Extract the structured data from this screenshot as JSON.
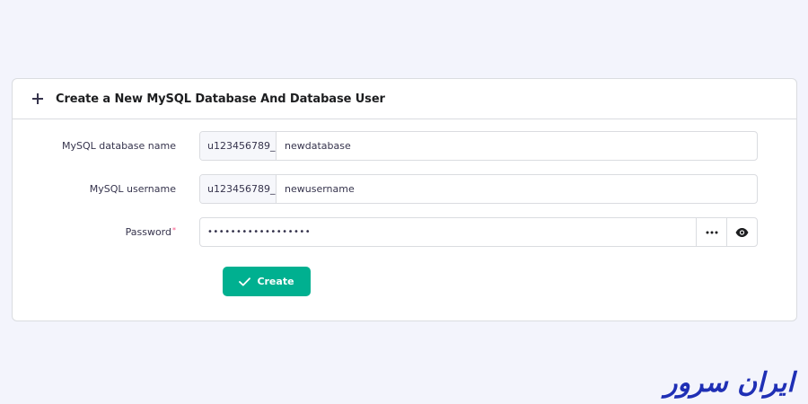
{
  "card": {
    "title": "Create a New MySQL Database And Database User"
  },
  "form": {
    "db_name": {
      "label": "MySQL database name",
      "prefix": "u123456789_",
      "value": "newdatabase"
    },
    "username": {
      "label": "MySQL username",
      "prefix": "u123456789_",
      "value": "newusername"
    },
    "password": {
      "label": "Password",
      "required_mark": "*",
      "value": "••••••••••••••••••"
    },
    "submit_label": "Create"
  },
  "icons": {
    "header": "plus-icon",
    "generate": "generate-password-icon",
    "reveal": "eye-icon",
    "submit": "checkmark-icon"
  },
  "brand": {
    "name": "ایران سرور",
    "color": "#1f2fb5"
  },
  "colors": {
    "accent": "#00b090",
    "background": "#f3f4fc",
    "required": "#fc5185"
  }
}
